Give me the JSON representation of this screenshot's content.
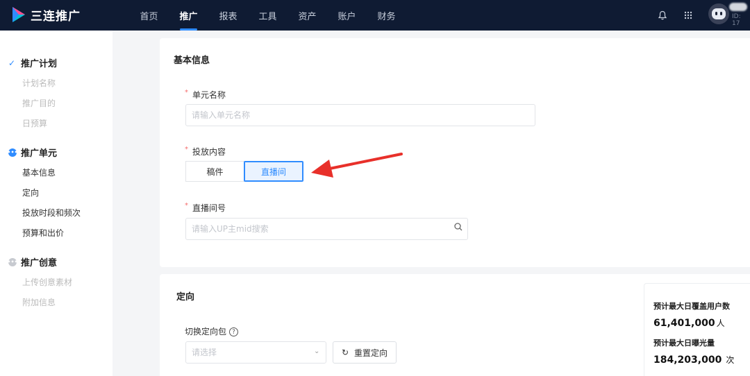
{
  "app": {
    "name": "三连推广",
    "user_id": "ID: 17"
  },
  "nav": {
    "items": [
      "首页",
      "推广",
      "报表",
      "工具",
      "资产",
      "账户",
      "财务"
    ],
    "active_index": 1
  },
  "sidebar": {
    "groups": [
      {
        "label": "推广计划",
        "status": "done",
        "items": [
          "计划名称",
          "推广目的",
          "日预算"
        ]
      },
      {
        "label": "推广单元",
        "status": "current",
        "items": [
          "基本信息",
          "定向",
          "投放时段和频次",
          "预算和出价"
        ]
      },
      {
        "label": "推广创意",
        "status": "pending",
        "items": [
          "上传创意素材",
          "附加信息"
        ]
      }
    ]
  },
  "basic_info": {
    "title": "基本信息",
    "unit_name": {
      "label": "单元名称",
      "placeholder": "请输入单元名称",
      "value": ""
    },
    "delivery_content": {
      "label": "投放内容",
      "options": [
        "稿件",
        "直播间"
      ],
      "selected": "直播间"
    },
    "live_room": {
      "label": "直播间号",
      "placeholder": "请输入UP主mid搜索",
      "value": ""
    }
  },
  "targeting": {
    "title": "定向",
    "switch_label": "切换定向包",
    "select_placeholder": "请选择",
    "reset_button": "重置定向"
  },
  "stats": {
    "users_label": "预计最大日覆盖用户数",
    "users_value": "61,401,000",
    "users_unit": "人",
    "exposure_label": "预计最大日曝光量",
    "exposure_value": "184,203,000",
    "exposure_unit": "次"
  },
  "colors": {
    "nav_bg": "#0f1b33",
    "accent": "#2f8cff",
    "annotation_arrow": "#e8302a"
  }
}
